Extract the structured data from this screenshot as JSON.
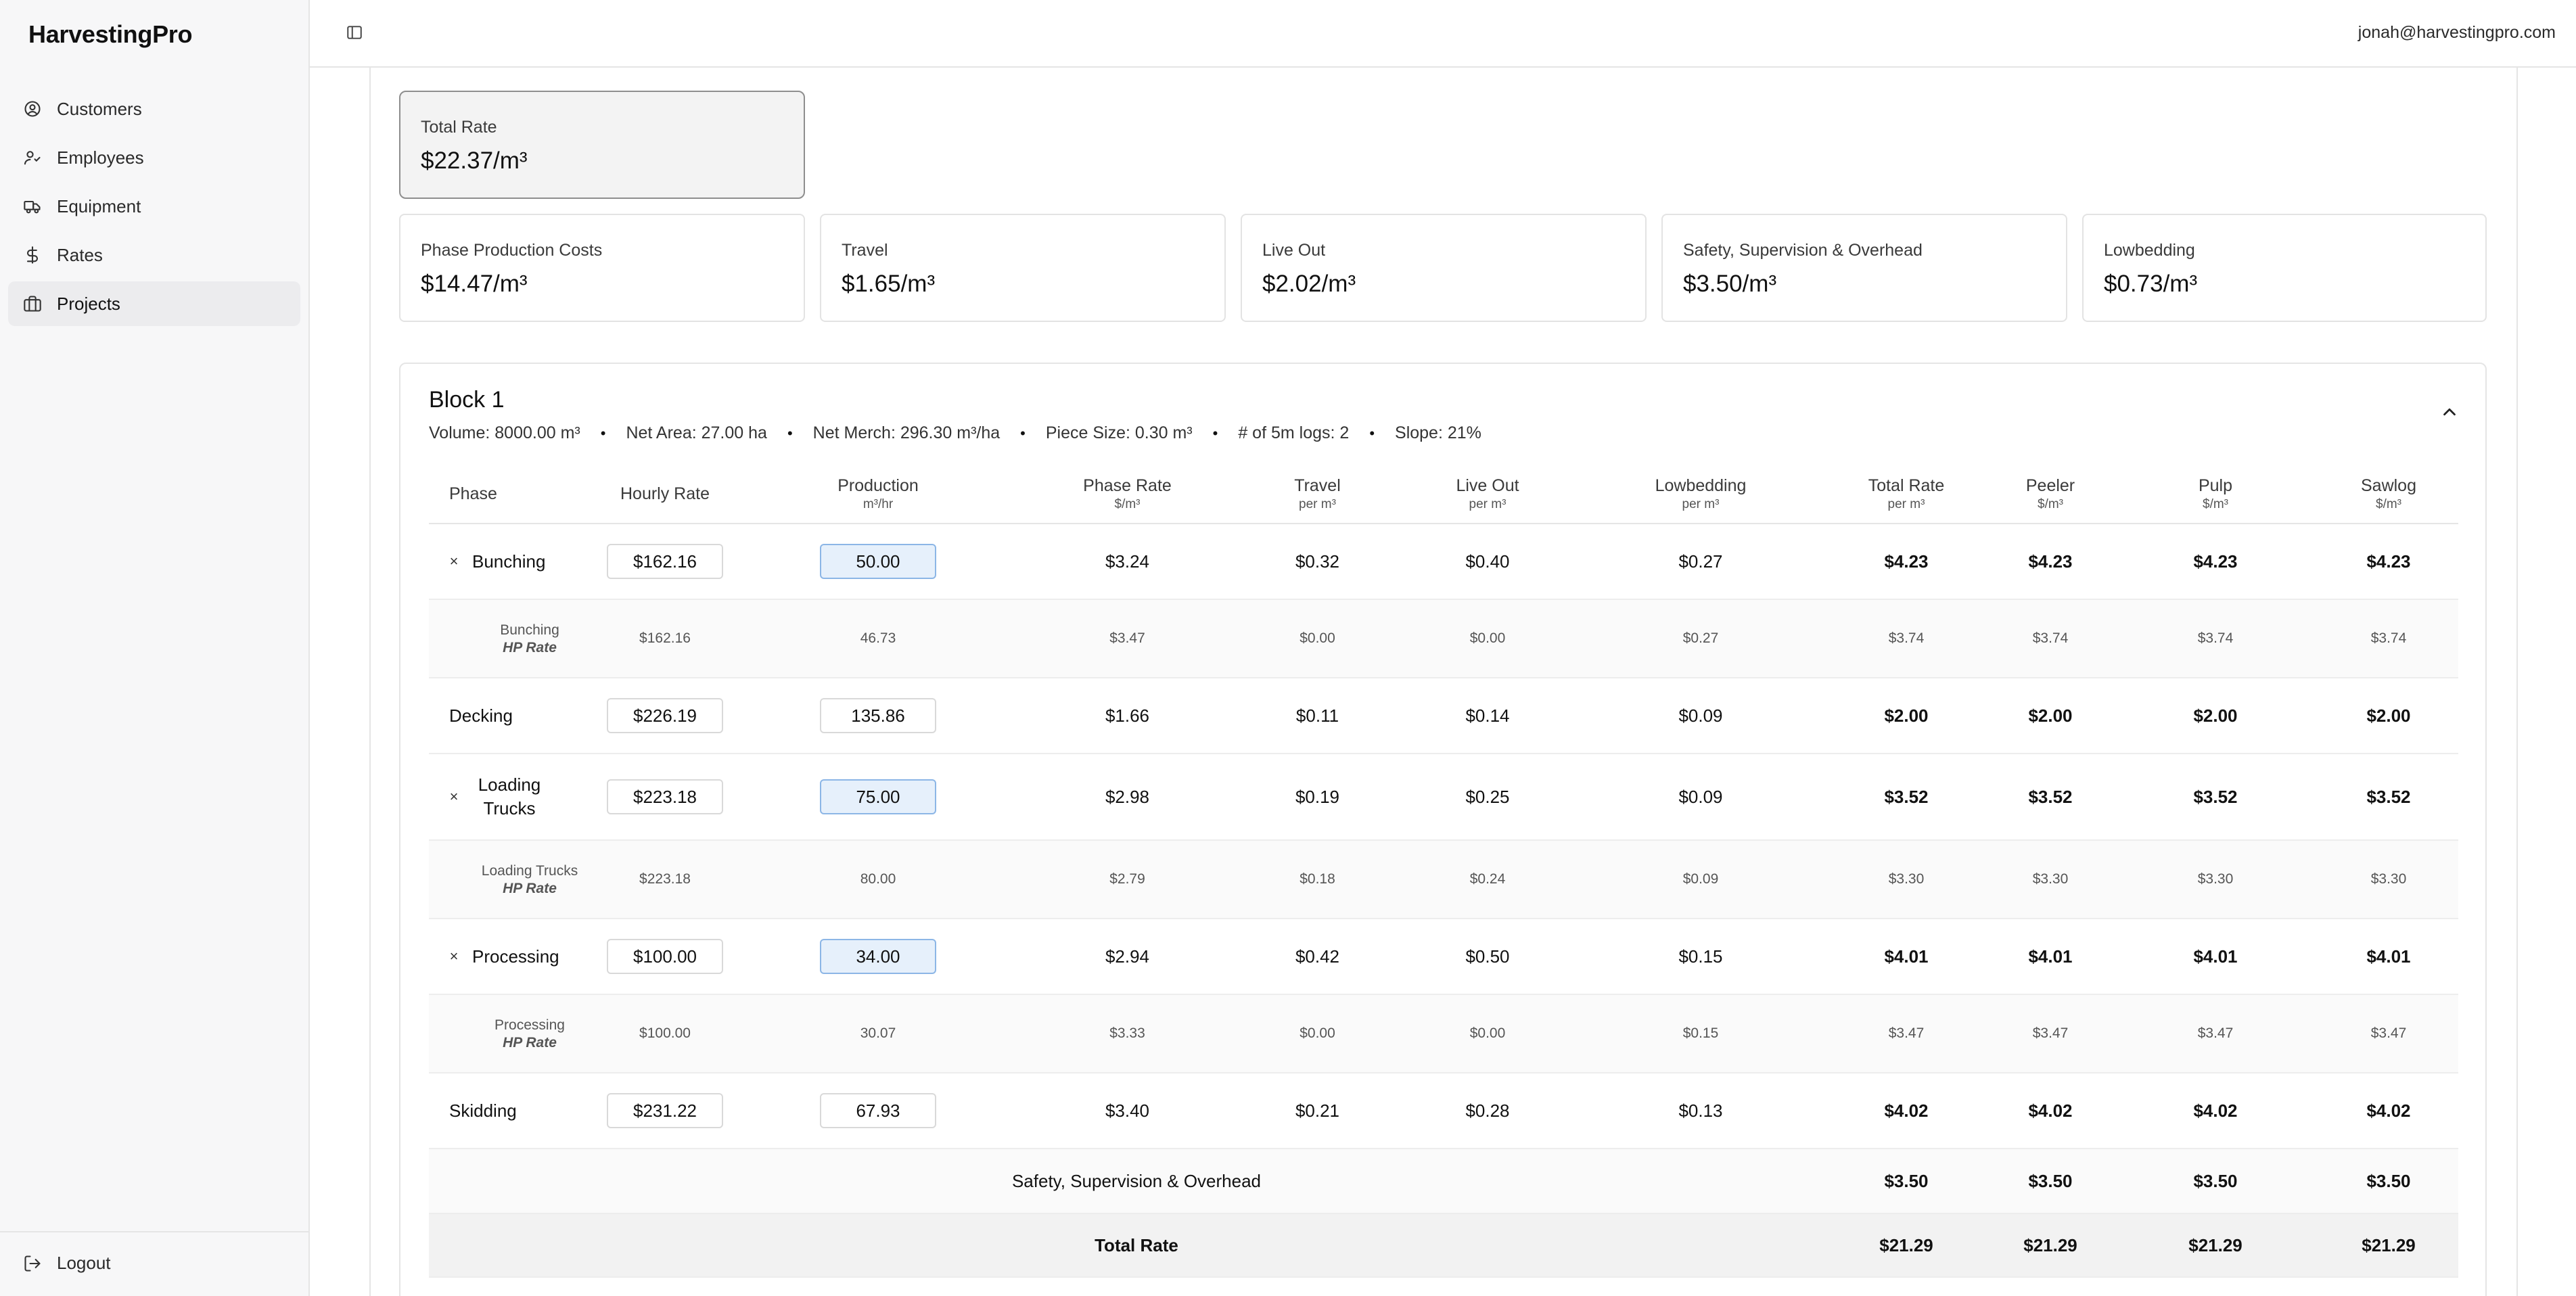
{
  "app": {
    "brand": "HarvestingPro",
    "user_email": "jonah@harvestingpro.com"
  },
  "sidebar": {
    "items": [
      {
        "label": "Customers",
        "icon": "user-circle-icon",
        "active": false
      },
      {
        "label": "Employees",
        "icon": "users-icon",
        "active": false
      },
      {
        "label": "Equipment",
        "icon": "truck-icon",
        "active": false
      },
      {
        "label": "Rates",
        "icon": "dollar-icon",
        "active": false
      },
      {
        "label": "Projects",
        "icon": "briefcase-icon",
        "active": true
      }
    ],
    "logout_label": "Logout"
  },
  "summary": {
    "total": {
      "label": "Total Rate",
      "value": "$22.37/m³"
    },
    "cards": [
      {
        "label": "Phase Production Costs",
        "value": "$14.47/m³"
      },
      {
        "label": "Travel",
        "value": "$1.65/m³"
      },
      {
        "label": "Live Out",
        "value": "$2.02/m³"
      },
      {
        "label": "Safety, Supervision & Overhead",
        "value": "$3.50/m³"
      },
      {
        "label": "Lowbedding",
        "value": "$0.73/m³"
      }
    ]
  },
  "block": {
    "title": "Block 1",
    "meta": [
      "Volume: 8000.00 m³",
      "Net Area: 27.00 ha",
      "Net Merch: 296.30 m³/ha",
      "Piece Size: 0.30 m³",
      "# of 5m logs: 2",
      "Slope: 21%"
    ],
    "columns": [
      {
        "label": "Phase",
        "sub": ""
      },
      {
        "label": "Hourly Rate",
        "sub": ""
      },
      {
        "label": "Production",
        "sub": "m³/hr"
      },
      {
        "label": "Phase Rate",
        "sub": "$/m³"
      },
      {
        "label": "Travel",
        "sub": "per m³"
      },
      {
        "label": "Live Out",
        "sub": "per m³"
      },
      {
        "label": "Lowbedding",
        "sub": "per m³"
      },
      {
        "label": "Total Rate",
        "sub": "per m³"
      },
      {
        "label": "Peeler",
        "sub": "$/m³"
      },
      {
        "label": "Pulp",
        "sub": "$/m³"
      },
      {
        "label": "Sawlog",
        "sub": "$/m³"
      }
    ],
    "rows": [
      {
        "phase": "Bunching",
        "removable": true,
        "remove_glyph": "×",
        "hourly": "$162.16",
        "production": "50.00",
        "highlight": true,
        "phase_rate": "$3.24",
        "travel": "$0.32",
        "live_out": "$0.40",
        "lowbedding": "$0.27",
        "total": "$4.23",
        "peeler": "$4.23",
        "pulp": "$4.23",
        "sawlog": "$4.23",
        "hp": {
          "name": "Bunching",
          "tag": "HP Rate",
          "hourly": "$162.16",
          "production": "46.73",
          "phase_rate": "$3.47",
          "travel": "$0.00",
          "live_out": "$0.00",
          "lowbedding": "$0.27",
          "total": "$3.74",
          "peeler": "$3.74",
          "pulp": "$3.74",
          "sawlog": "$3.74"
        }
      },
      {
        "phase": "Decking",
        "removable": false,
        "hourly": "$226.19",
        "production": "135.86",
        "highlight": false,
        "phase_rate": "$1.66",
        "travel": "$0.11",
        "live_out": "$0.14",
        "lowbedding": "$0.09",
        "total": "$2.00",
        "peeler": "$2.00",
        "pulp": "$2.00",
        "sawlog": "$2.00"
      },
      {
        "phase": "Loading Trucks",
        "removable": true,
        "remove_glyph": "×",
        "hourly": "$223.18",
        "production": "75.00",
        "highlight": true,
        "phase_rate": "$2.98",
        "travel": "$0.19",
        "live_out": "$0.25",
        "lowbedding": "$0.09",
        "total": "$3.52",
        "peeler": "$3.52",
        "pulp": "$3.52",
        "sawlog": "$3.52",
        "hp": {
          "name": "Loading Trucks",
          "tag": "HP Rate",
          "hourly": "$223.18",
          "production": "80.00",
          "phase_rate": "$2.79",
          "travel": "$0.18",
          "live_out": "$0.24",
          "lowbedding": "$0.09",
          "total": "$3.30",
          "peeler": "$3.30",
          "pulp": "$3.30",
          "sawlog": "$3.30"
        }
      },
      {
        "phase": "Processing",
        "removable": true,
        "remove_glyph": "×",
        "hourly": "$100.00",
        "production": "34.00",
        "highlight": true,
        "phase_rate": "$2.94",
        "travel": "$0.42",
        "live_out": "$0.50",
        "lowbedding": "$0.15",
        "total": "$4.01",
        "peeler": "$4.01",
        "pulp": "$4.01",
        "sawlog": "$4.01",
        "hp": {
          "name": "Processing",
          "tag": "HP Rate",
          "hourly": "$100.00",
          "production": "30.07",
          "phase_rate": "$3.33",
          "travel": "$0.00",
          "live_out": "$0.00",
          "lowbedding": "$0.15",
          "total": "$3.47",
          "peeler": "$3.47",
          "pulp": "$3.47",
          "sawlog": "$3.47"
        }
      },
      {
        "phase": "Skidding",
        "removable": false,
        "hourly": "$231.22",
        "production": "67.93",
        "highlight": false,
        "phase_rate": "$3.40",
        "travel": "$0.21",
        "live_out": "$0.28",
        "lowbedding": "$0.13",
        "total": "$4.02",
        "peeler": "$4.02",
        "pulp": "$4.02",
        "sawlog": "$4.02"
      }
    ],
    "sso": {
      "label": "Safety, Supervision & Overhead",
      "total": "$3.50",
      "peeler": "$3.50",
      "pulp": "$3.50",
      "sawlog": "$3.50"
    },
    "total_row": {
      "label": "Total Rate",
      "total": "$21.29",
      "peeler": "$21.29",
      "pulp": "$21.29",
      "sawlog": "$21.29"
    }
  }
}
